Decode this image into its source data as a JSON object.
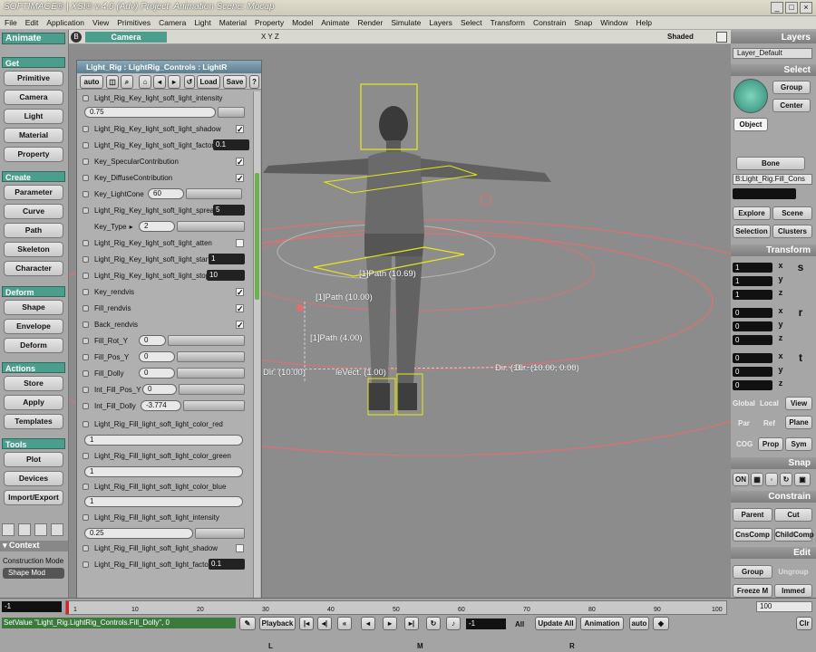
{
  "titlebar": {
    "title": "SOFTIMAGE® | XSI® v.4.0 (Adv) Project: Animation    Scene: Mocap"
  },
  "menubar": {
    "items": [
      "File",
      "Edit",
      "Application",
      "View",
      "Primitives",
      "Camera",
      "Light",
      "Material",
      "Property",
      "Model",
      "Animate",
      "Render",
      "Simulate",
      "Layers",
      "Select",
      "Transform",
      "Constrain",
      "Snap",
      "Window",
      "Help"
    ]
  },
  "left": {
    "mode": "Animate",
    "get_header": "Get",
    "get_buttons": [
      "Primitive",
      "Camera",
      "Light",
      "Material",
      "Property"
    ],
    "create_header": "Create",
    "create_buttons": [
      "Parameter",
      "Curve",
      "Path",
      "Skeleton",
      "Character"
    ],
    "deform_header": "Deform",
    "deform_buttons": [
      "Shape",
      "Envelope",
      "Deform"
    ],
    "actions_header": "Actions",
    "actions_buttons": [
      "Store",
      "Apply",
      "Templates"
    ],
    "tools_header": "Tools",
    "tools_buttons": [
      "Plot",
      "Devices",
      "Import/Export"
    ],
    "context_label": "Context",
    "construction_mode_label": "Construction Mode",
    "construction_mode_value": "Shape Mod"
  },
  "viewport": {
    "view_name": "Camera",
    "axes": "X Y Z",
    "display_mode": "Shaded",
    "labels": [
      "[1]Path (10.69)",
      "[1]Path (10.00)",
      "[1]Path (4.00)",
      "Dir. (10.00)",
      "Dir. (10.00, 0.00)"
    ],
    "partial_label_a": "leVect. (1.00)",
    "partial_label_b": "Dir. (10."
  },
  "ppg": {
    "title": "Light_Rig : LightRig_Controls : LightR",
    "auto_label": "auto",
    "load_label": "Load",
    "save_label": "Save",
    "help_label": "?",
    "rows": [
      {
        "label": "Light_Rig_Key_light_soft_light_intensity"
      },
      {
        "label": "Light_Rig_Key_light_soft_light_shadow"
      },
      {
        "label": "Light_Rig_Key_light_soft_light_factor"
      },
      {
        "label": "Key_SpecularContribution"
      },
      {
        "label": "Key_DiffuseContribution"
      },
      {
        "label": "Key_LightCone"
      },
      {
        "label": "Light_Rig_Key_light_soft_light_spread"
      },
      {
        "label": "Key_Type"
      },
      {
        "label": "Light_Rig_Key_light_soft_light_atten"
      },
      {
        "label": "Light_Rig_Key_light_soft_light_start"
      },
      {
        "label": "Light_Rig_Key_light_soft_light_stop"
      },
      {
        "label": "Key_rendvis"
      },
      {
        "label": "Fill_rendvis"
      },
      {
        "label": "Back_rendvis"
      },
      {
        "label": "Fill_Rot_Y"
      },
      {
        "label": "Fill_Pos_Y"
      },
      {
        "label": "Fill_Dolly"
      },
      {
        "label": "Int_Fill_Pos_Y"
      },
      {
        "label": "Int_Fill_Dolly"
      },
      {
        "label": "Light_Rig_Fill_light_soft_light_color_red"
      },
      {
        "label": "Light_Rig_Fill_light_soft_light_color_green"
      },
      {
        "label": "Light_Rig_Fill_light_soft_light_color_blue"
      },
      {
        "label": "Light_Rig_Fill_light_soft_light_intensity"
      },
      {
        "label": "Light_Rig_Fill_light_soft_light_shadow"
      },
      {
        "label": "Light_Rig_Fill_light_soft_light_factor"
      }
    ],
    "values": {
      "key_intensity": "0.75",
      "key_factor": "0.1",
      "key_cone": "60",
      "key_spread": "5",
      "key_type": "2",
      "key_start": "1",
      "key_stop": "10",
      "fill_rot_y": "0",
      "fill_pos_y": "0",
      "fill_dolly": "0",
      "int_fill_pos_y": "0",
      "int_fill_dolly": "-3.774",
      "fill_red": "1",
      "fill_green": "1",
      "fill_blue": "1",
      "fill_intensity": "0.25",
      "fill_factor": "0.1"
    }
  },
  "right": {
    "layers_header": "Layers",
    "layer_value": "Layer_Default",
    "select_header": "Select",
    "group_btn": "Group",
    "center_btn": "Center",
    "object_btn": "Object",
    "bone_btn": "Bone",
    "selection_field": "B:Light_Rig.Fill_Cons",
    "explore_btn": "Explore",
    "scene_btn": "Scene",
    "selection_btn": "Selection",
    "clusters_btn": "Clusters",
    "transform_header": "Transform",
    "scale": [
      "1",
      "1",
      "1"
    ],
    "rotate": [
      "0",
      "0",
      "0"
    ],
    "translate": [
      "0",
      "0",
      "0"
    ],
    "global_btn": "Global",
    "local_btn": "Local",
    "view_btn": "View",
    "par_btn": "Par",
    "ref_btn": "Ref",
    "plane_btn": "Plane",
    "cog_btn": "COG",
    "prop_btn": "Prop",
    "sym_btn": "Sym",
    "snap_header": "Snap",
    "on_btn": "ON",
    "constrain_header": "Constrain",
    "parent_btn": "Parent",
    "cut_btn": "Cut",
    "cnscomp_btn": "CnsComp",
    "childcomp_btn": "ChildComp",
    "edit_header": "Edit",
    "group2_btn": "Group",
    "ungroup_btn": "Ungroup",
    "freeze_btn": "Freeze M",
    "immed_btn": "Immed"
  },
  "bottom": {
    "timeline_start": "-1",
    "timeline_ticks": [
      "1",
      "10",
      "20",
      "30",
      "40",
      "50",
      "60",
      "70",
      "80",
      "90",
      "100"
    ],
    "timeline_end": "100",
    "command_line": "SetValue \"Light_Rig.LightRig_Controls.Fill_Dolly\", 0",
    "playback_label": "Playback",
    "frame_value": "-1",
    "all_label": "All",
    "update_all_label": "Update All",
    "animation_label": "Animation",
    "auto_label": "auto",
    "clr_label": "Clr",
    "mouse_l": "L",
    "mouse_m": "M",
    "mouse_r": "R"
  },
  "colors": {
    "header_teal": "#4c9e8c",
    "viewport_bg": "#8c8c8c",
    "selection_yellow": "#e8e818",
    "path_pink": "#e06a6a"
  }
}
